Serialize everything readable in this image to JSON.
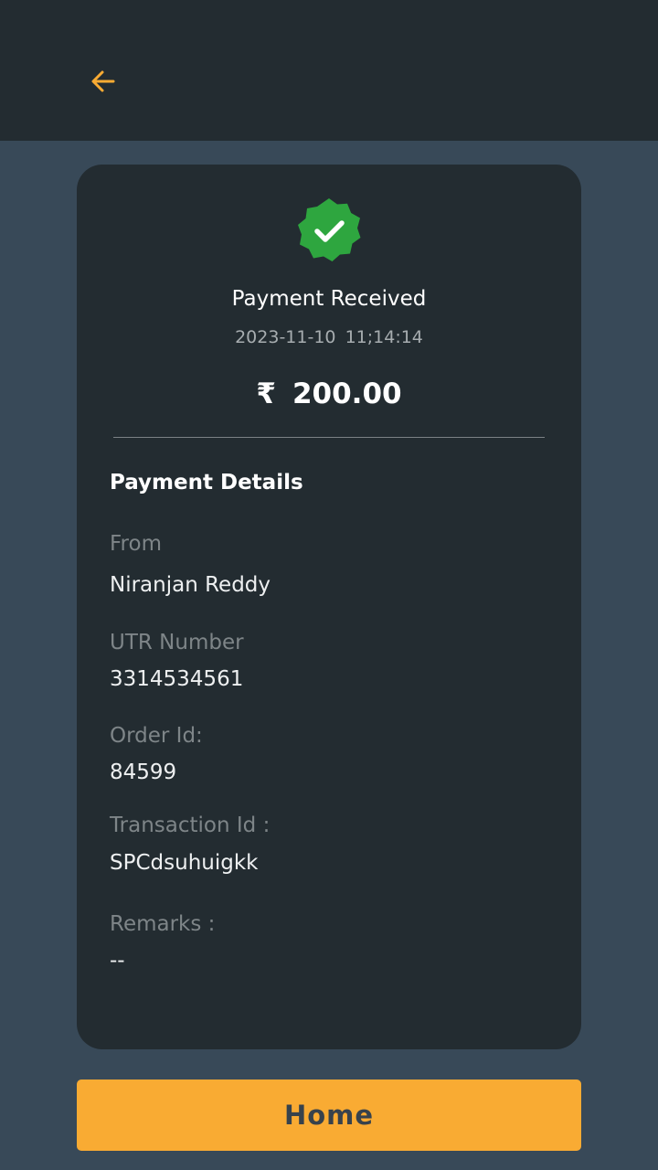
{
  "header": {
    "back_icon": "arrow-left-icon",
    "accent_color": "#f9ab33"
  },
  "status": {
    "icon": "verified-check-badge-icon",
    "badge_color": "#2ea63f",
    "title": "Payment Received",
    "date": "2023-11-10",
    "time": "11;14:14"
  },
  "amount": {
    "currency_symbol": "₹",
    "value": "200.00"
  },
  "details": {
    "section_title": "Payment Details",
    "from_label": "From",
    "from_value": "Niranjan Reddy",
    "utr_label": "UTR Number",
    "utr_value": "3314534561",
    "order_label": "Order Id:",
    "order_value": "84599",
    "transaction_label": "Transaction Id :",
    "transaction_value": "SPCdsuhuigkk",
    "remarks_label": "Remarks :",
    "remarks_value": "--"
  },
  "footer": {
    "home_label": "Home"
  }
}
